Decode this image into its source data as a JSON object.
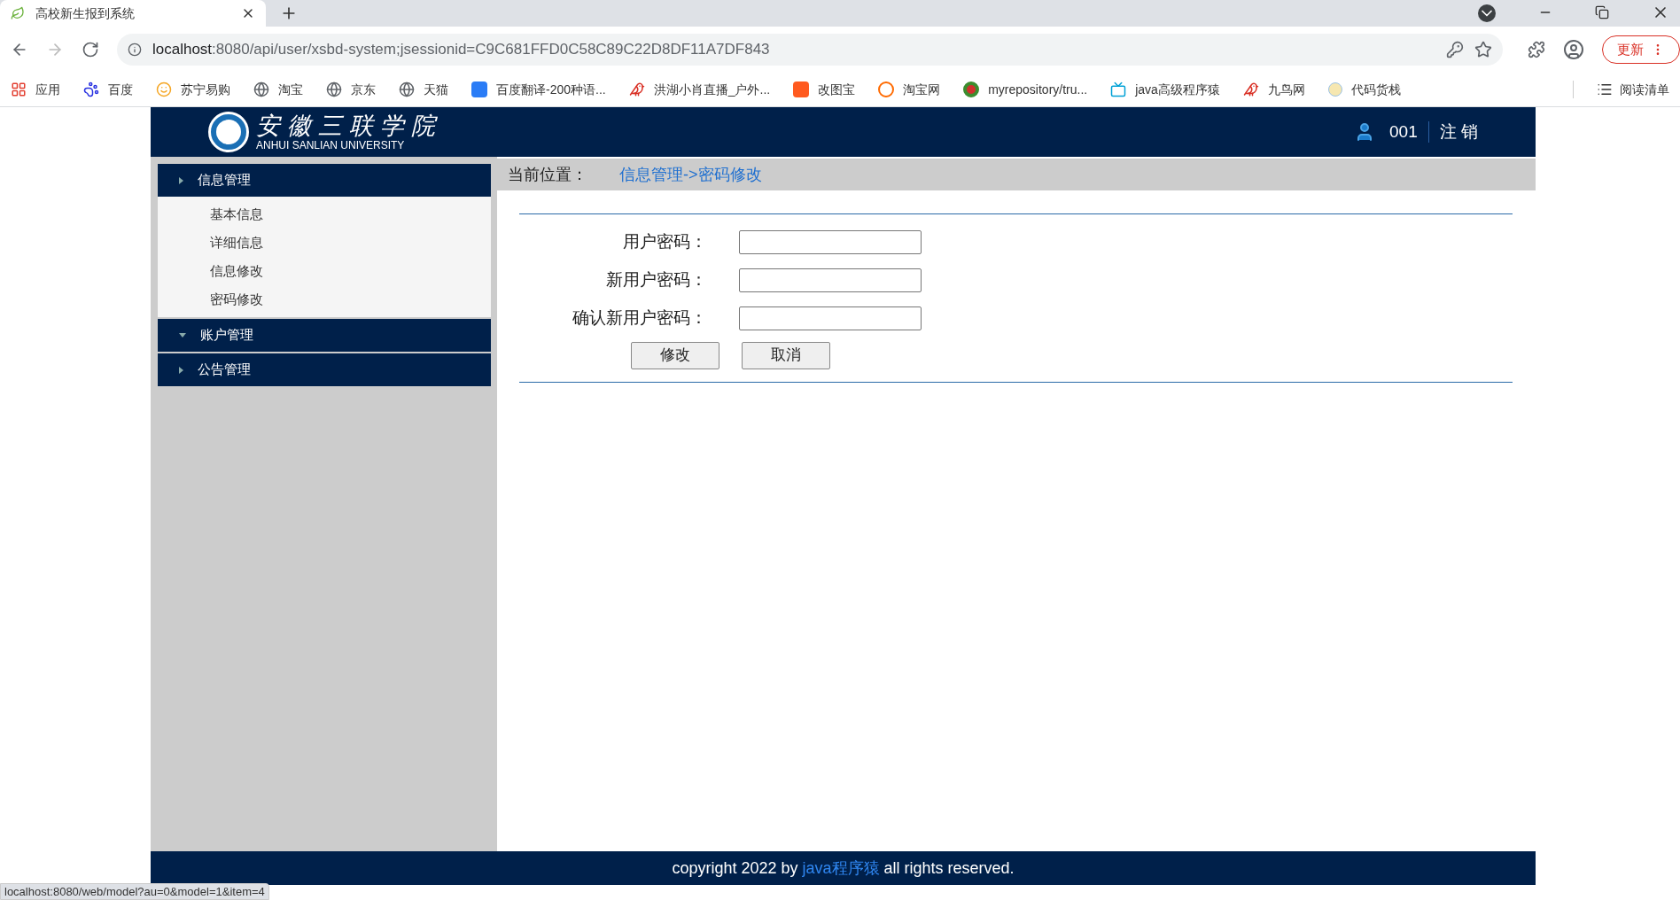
{
  "browser": {
    "tab_title": "高校新生报到系统",
    "url_host": "localhost",
    "url_rest": ":8080/api/user/xsbd-system;jsessionid=C9C681FFD0C58C89C22D8DF11A7DF843",
    "update_button": "更新",
    "bookmarks": [
      {
        "kind": "apps",
        "label": "应用"
      },
      {
        "kind": "paw",
        "label": "百度"
      },
      {
        "kind": "lion",
        "label": "苏宁易购"
      },
      {
        "kind": "globe",
        "label": "淘宝"
      },
      {
        "kind": "globe",
        "label": "京东"
      },
      {
        "kind": "globe",
        "label": "天猫"
      },
      {
        "kind": "translate",
        "label": "百度翻译-200种语..."
      },
      {
        "kind": "bird",
        "label": "洪湖小肖直播_户外..."
      },
      {
        "kind": "squares",
        "label": "改图宝"
      },
      {
        "kind": "tao",
        "label": "淘宝网"
      },
      {
        "kind": "ring",
        "label": "myrepository/tru..."
      },
      {
        "kind": "tv",
        "label": "java高级程序猿"
      },
      {
        "kind": "bird",
        "label": "九鸟网"
      },
      {
        "kind": "half",
        "label": "代码货栈"
      }
    ],
    "reading_list": "阅读清单"
  },
  "header": {
    "logo_cn": "安徽三联学院",
    "logo_en": "ANHUI SANLIAN UNIVERSITY",
    "user": "001",
    "logout": "注 销"
  },
  "sidebar": {
    "groups": [
      {
        "label": "信息管理",
        "expanded": true,
        "hovered": false,
        "children": [
          {
            "label": "基本信息"
          },
          {
            "label": "详细信息"
          },
          {
            "label": "信息修改"
          },
          {
            "label": "密码修改"
          }
        ]
      },
      {
        "label": "账户管理",
        "expanded": false,
        "hovered": true
      },
      {
        "label": "公告管理",
        "expanded": false,
        "hovered": false
      }
    ]
  },
  "breadcrumb": {
    "label": "当前位置：",
    "path": "信息管理->密码修改"
  },
  "form": {
    "fields": [
      {
        "label": "用户密码："
      },
      {
        "label": "新用户密码："
      },
      {
        "label": "确认新用户密码："
      }
    ],
    "buttons": [
      "修改",
      "取消"
    ]
  },
  "footer": {
    "prefix": "copyright 2022 by",
    "link": "java程序猿",
    "suffix": "all rights reserved."
  },
  "status_url": "localhost:8080/web/model?au=0&model=1&item=4"
}
